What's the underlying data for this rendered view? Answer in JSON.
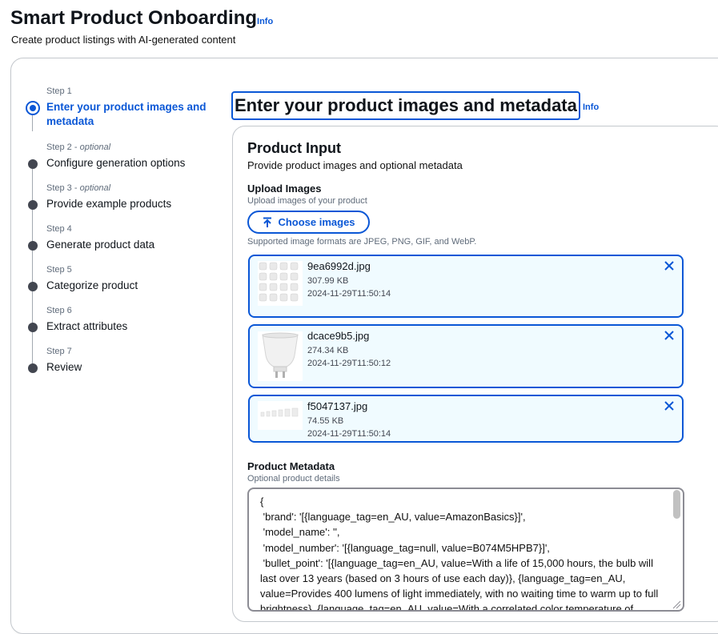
{
  "header": {
    "title": "Smart Product Onboarding",
    "info_label": "Info",
    "subtitle": "Create product listings with AI-generated content"
  },
  "steps": [
    {
      "label": "Step 1",
      "optional": "",
      "title": "Enter your product images and metadata",
      "state": "active"
    },
    {
      "label": "Step 2 - ",
      "optional": "optional",
      "title": "Configure generation options",
      "state": "pending"
    },
    {
      "label": "Step 3 - ",
      "optional": "optional",
      "title": "Provide example products",
      "state": "pending"
    },
    {
      "label": "Step 4",
      "optional": "",
      "title": "Generate product data",
      "state": "pending"
    },
    {
      "label": "Step 5",
      "optional": "",
      "title": "Categorize product",
      "state": "pending"
    },
    {
      "label": "Step 6",
      "optional": "",
      "title": "Extract attributes",
      "state": "pending"
    },
    {
      "label": "Step 7",
      "optional": "",
      "title": "Review",
      "state": "pending"
    }
  ],
  "main": {
    "heading": "Enter your product images and metadata",
    "info_label": "Info",
    "product_input": {
      "title": "Product Input",
      "description": "Provide product images and optional metadata"
    },
    "upload": {
      "label": "Upload Images",
      "description": "Upload images of your product",
      "button_label": "Choose images",
      "hint": "Supported image formats are JPEG, PNG, GIF, and WebP."
    },
    "files": [
      {
        "name": "9ea6992d.jpg",
        "size": "307.99 KB",
        "modified": "2024-11-29T11:50:14"
      },
      {
        "name": "dcace9b5.jpg",
        "size": "274.34 KB",
        "modified": "2024-11-29T11:50:12"
      },
      {
        "name": "f5047137.jpg",
        "size": "74.55 KB",
        "modified": "2024-11-29T11:50:14"
      }
    ],
    "metadata": {
      "label": "Product Metadata",
      "description": "Optional product details",
      "value": "{\n 'brand': '[{language_tag=en_AU, value=AmazonBasics}]',\n 'model_name': '',\n 'model_number': '[{language_tag=null, value=B074M5HPB7}]',\n 'bullet_point': '[{language_tag=en_AU, value=With a life of 15,000 hours, the bulb will last over 13 years (based on 3 hours of use each day)}, {language_tag=en_AU, value=Provides 400 lumens of light immediately, with no waiting time to warm up to full brightness}, {language_tag=en_AU, value=With a correlated color temperature of"
    }
  },
  "colors": {
    "accent": "#0a57d6",
    "file_card_bg": "#f0fbff",
    "step_dot": "#424650"
  }
}
